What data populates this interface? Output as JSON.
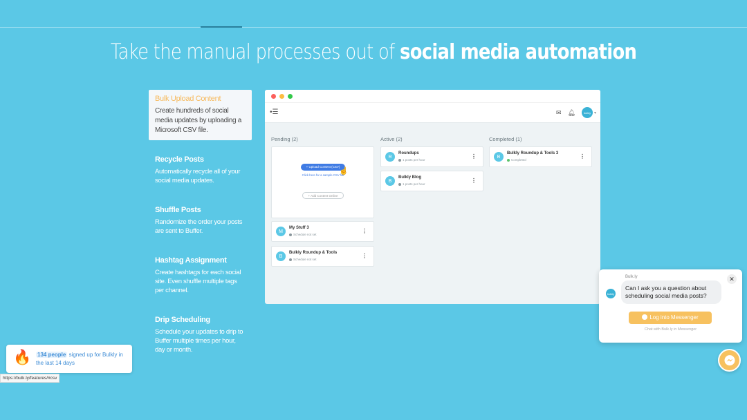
{
  "headline": {
    "normal": "Take the manual processes out of ",
    "bold": "social media automation"
  },
  "features": [
    {
      "title": "Bulk Upload Content",
      "desc": "Create hundreds of social media updates by uploading a Microsoft CSV file."
    },
    {
      "title": "Recycle Posts",
      "desc": "Automatically recycle all of your social media updates."
    },
    {
      "title": "Shuffle Posts",
      "desc": "Randomize the order your posts are sent to Buffer."
    },
    {
      "title": "Hashtag Assignment",
      "desc": "Create hashtags for each social site. Even shuffle multiple tags per channel."
    },
    {
      "title": "Drip Scheduling",
      "desc": "Schedule your updates to drip to Buffer multiple times per hour, day or month."
    }
  ],
  "app": {
    "colors": {
      "close": "#fc605c",
      "minimize": "#fdbc40",
      "maximize": "#34c84a"
    },
    "avatar_label": "bulkly",
    "columns": {
      "pending": {
        "header": "Pending (2)",
        "upload_button": "+ Upload Content (CSV)",
        "sample_link": "Click here for a sample CSV file",
        "add_online": "+ Add Content Online",
        "cards": [
          {
            "initial": "M",
            "title": "My Stuff 3",
            "status": "Schedule not set"
          },
          {
            "initial": "B",
            "title": "Bulkly Roundup & Tools",
            "status": "Schedule not set"
          }
        ]
      },
      "active": {
        "header": "Active (2)",
        "cards": [
          {
            "initial": "R",
            "title": "Roundups",
            "status": "1 posts per hour"
          },
          {
            "initial": "B",
            "title": "Bulkly Blog",
            "status": "1 posts per hour"
          }
        ]
      },
      "completed": {
        "header": "Completed (1)",
        "cards": [
          {
            "initial": "B",
            "title": "Bulkly Roundup & Tools 3",
            "status": "Completed"
          }
        ]
      }
    }
  },
  "chat": {
    "sender": "Bulk.ly",
    "avatar_label": "bulkly",
    "message": "Can I ask you a question about scheduling social media posts?",
    "button": "Log into Messenger",
    "footer": "Chat with Bulk.ly in Messenger"
  },
  "social_proof": {
    "count": "134 people",
    "text": " signed up for Bulkly in the last 14 days"
  },
  "status_url": "https://bulk.ly/features/#csv"
}
